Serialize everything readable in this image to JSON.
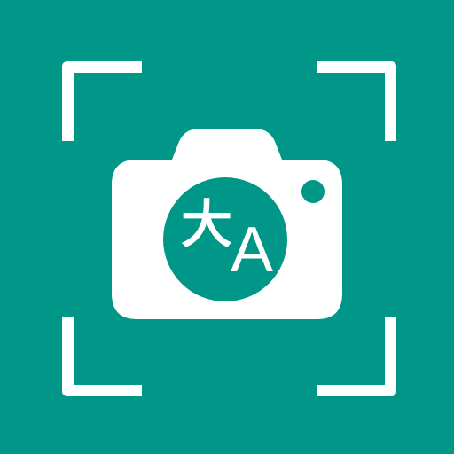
{
  "icon": {
    "name": "camera-translate-app-icon",
    "background_color": "#009688",
    "foreground_color": "#ffffff",
    "glyphs": {
      "han": "大",
      "latin": "A"
    },
    "icons": [
      "viewfinder-corner-icon",
      "camera-icon",
      "translate-icon"
    ]
  }
}
